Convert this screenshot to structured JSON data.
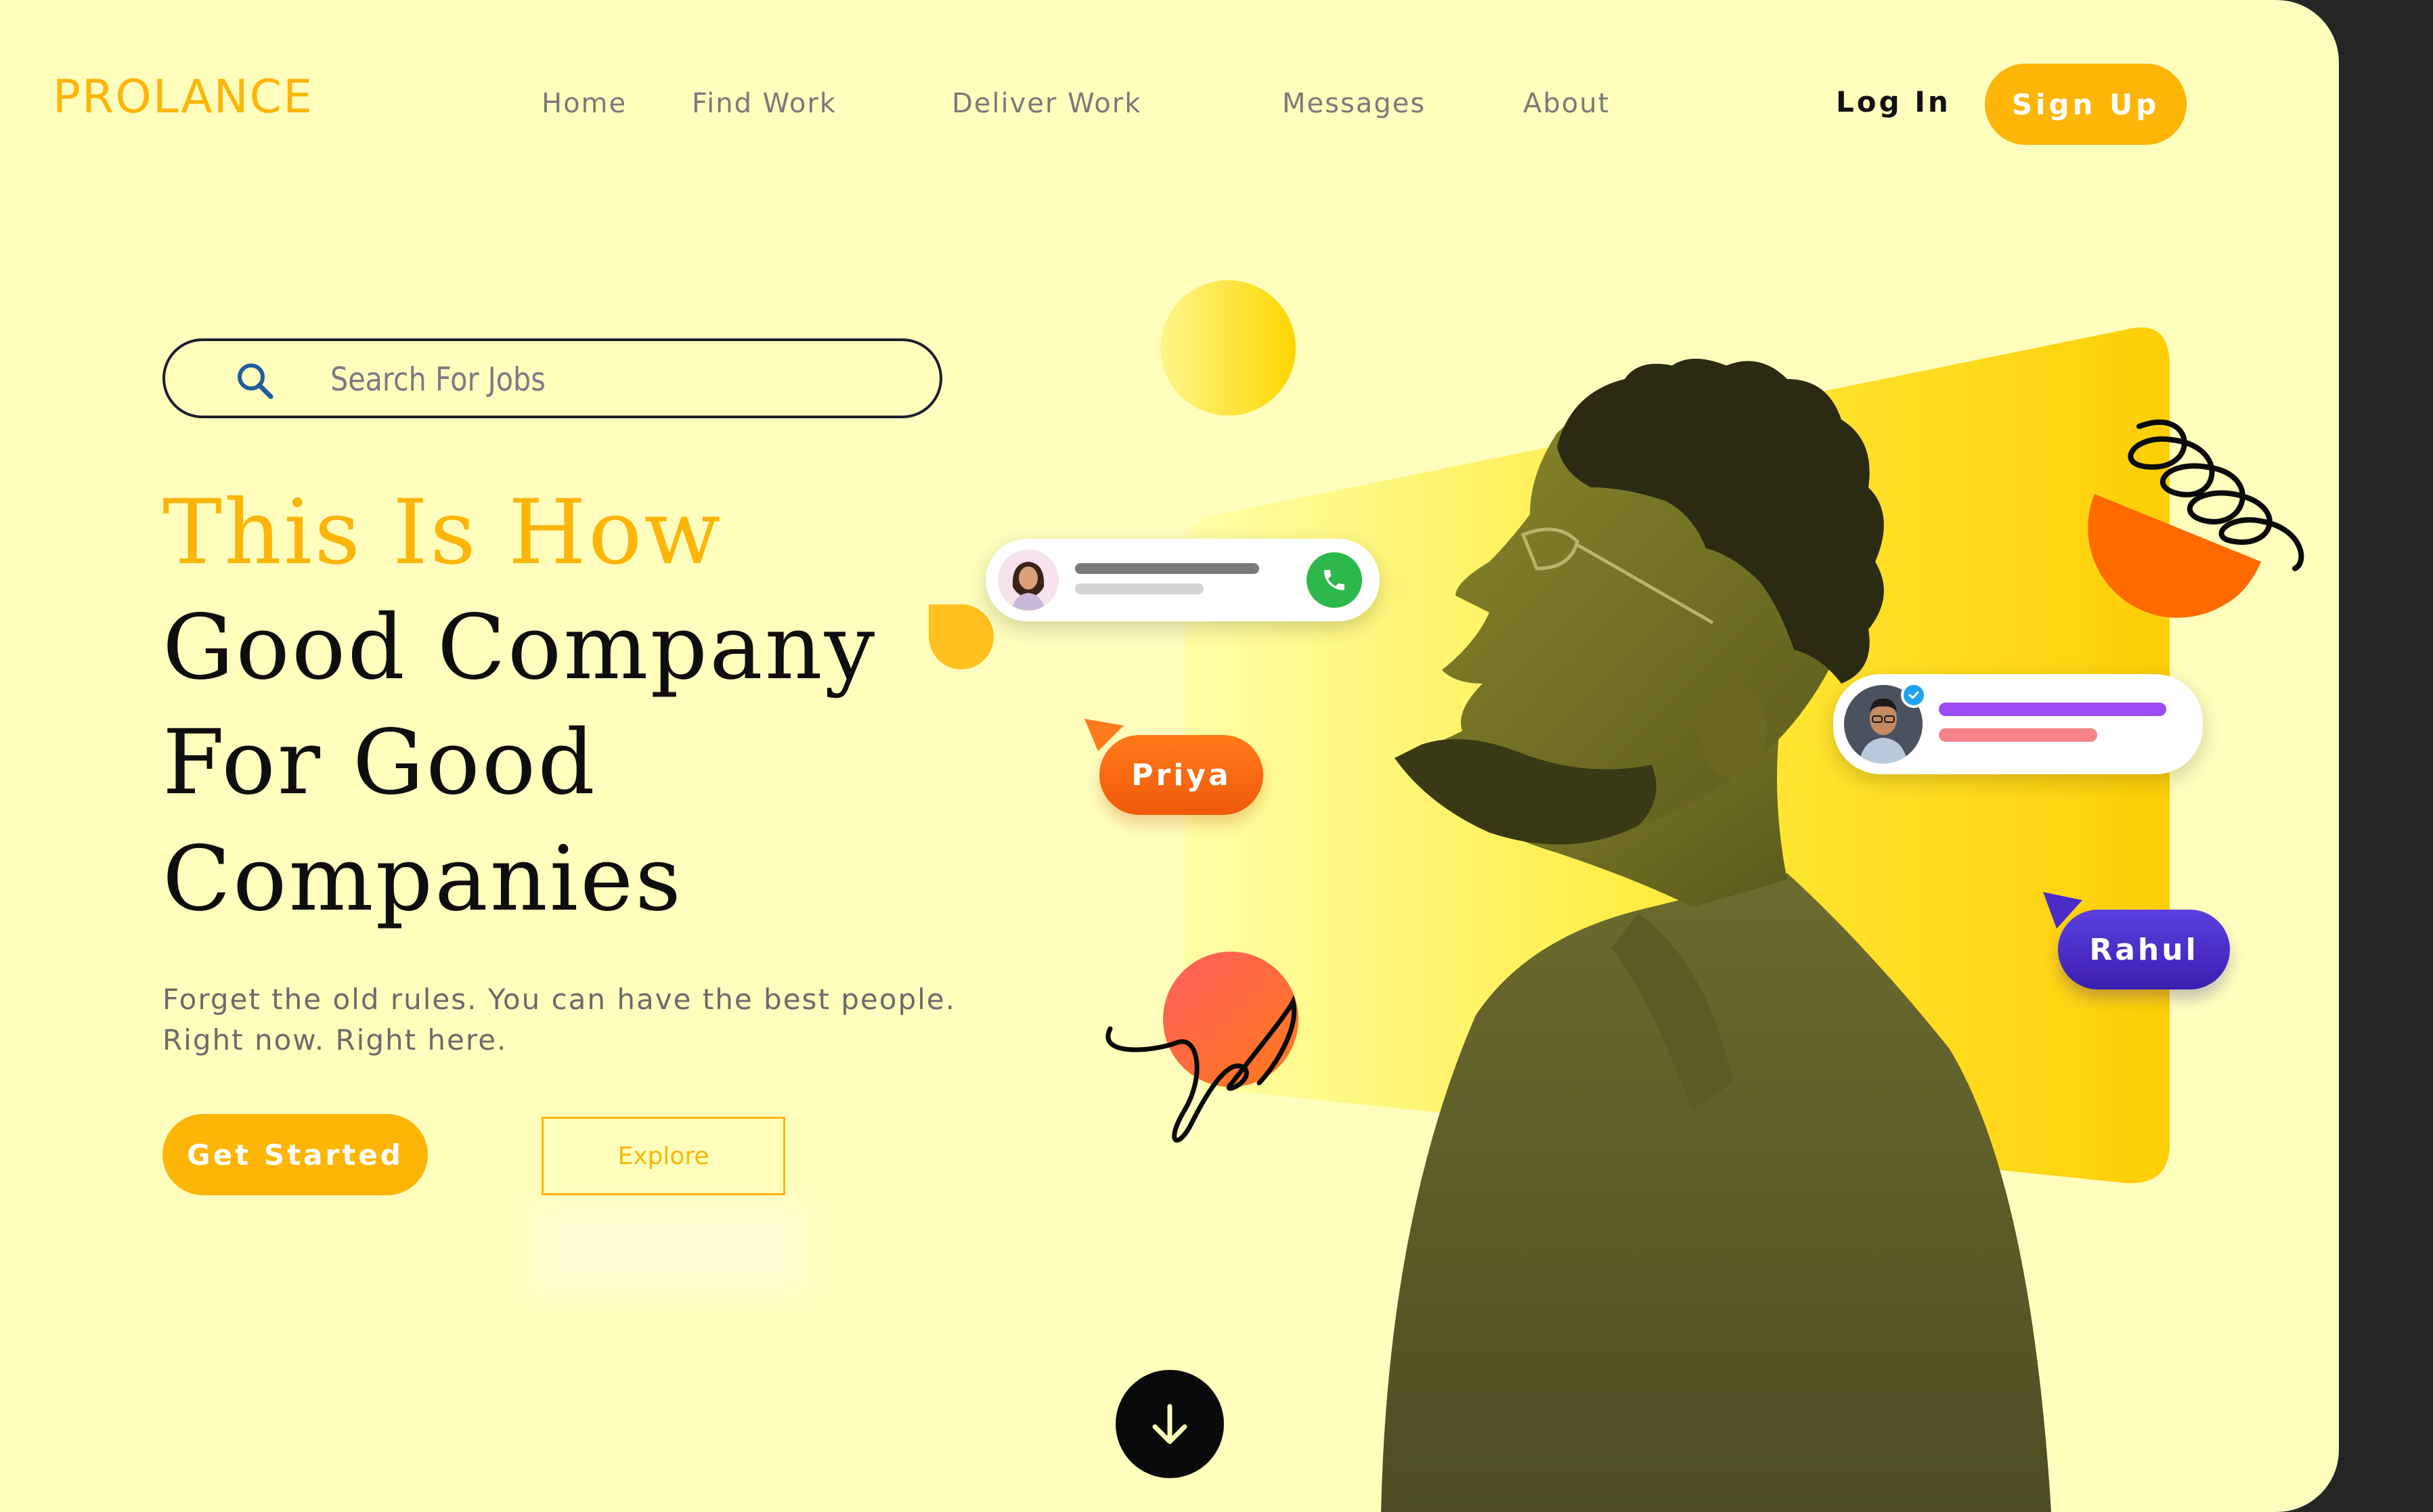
{
  "brand": {
    "logo_text": "PROLANCE"
  },
  "nav": {
    "items": [
      {
        "label": "Home"
      },
      {
        "label": "Find Work"
      },
      {
        "label": "Deliver Work"
      },
      {
        "label": "Messages"
      },
      {
        "label": "About"
      }
    ],
    "login_label": "Log In",
    "signup_label": "Sign Up"
  },
  "search": {
    "placeholder": "Search For Jobs"
  },
  "hero": {
    "headline": [
      "This Is How",
      "Good Company",
      "For Good",
      "Companies"
    ],
    "subtitle": [
      "Forget the old rules. You can have the best people.",
      "Right now. Right here."
    ],
    "primary_cta": "Get Started",
    "secondary_cta": "Explore"
  },
  "chips": {
    "priya": "Priya",
    "rahul": "Rahul"
  },
  "colors": {
    "background": "#FFFEBD",
    "accent": "#FDB508",
    "orange": "#F26A12",
    "purple": "#4A2DC8",
    "call_green": "#2DB84C"
  }
}
